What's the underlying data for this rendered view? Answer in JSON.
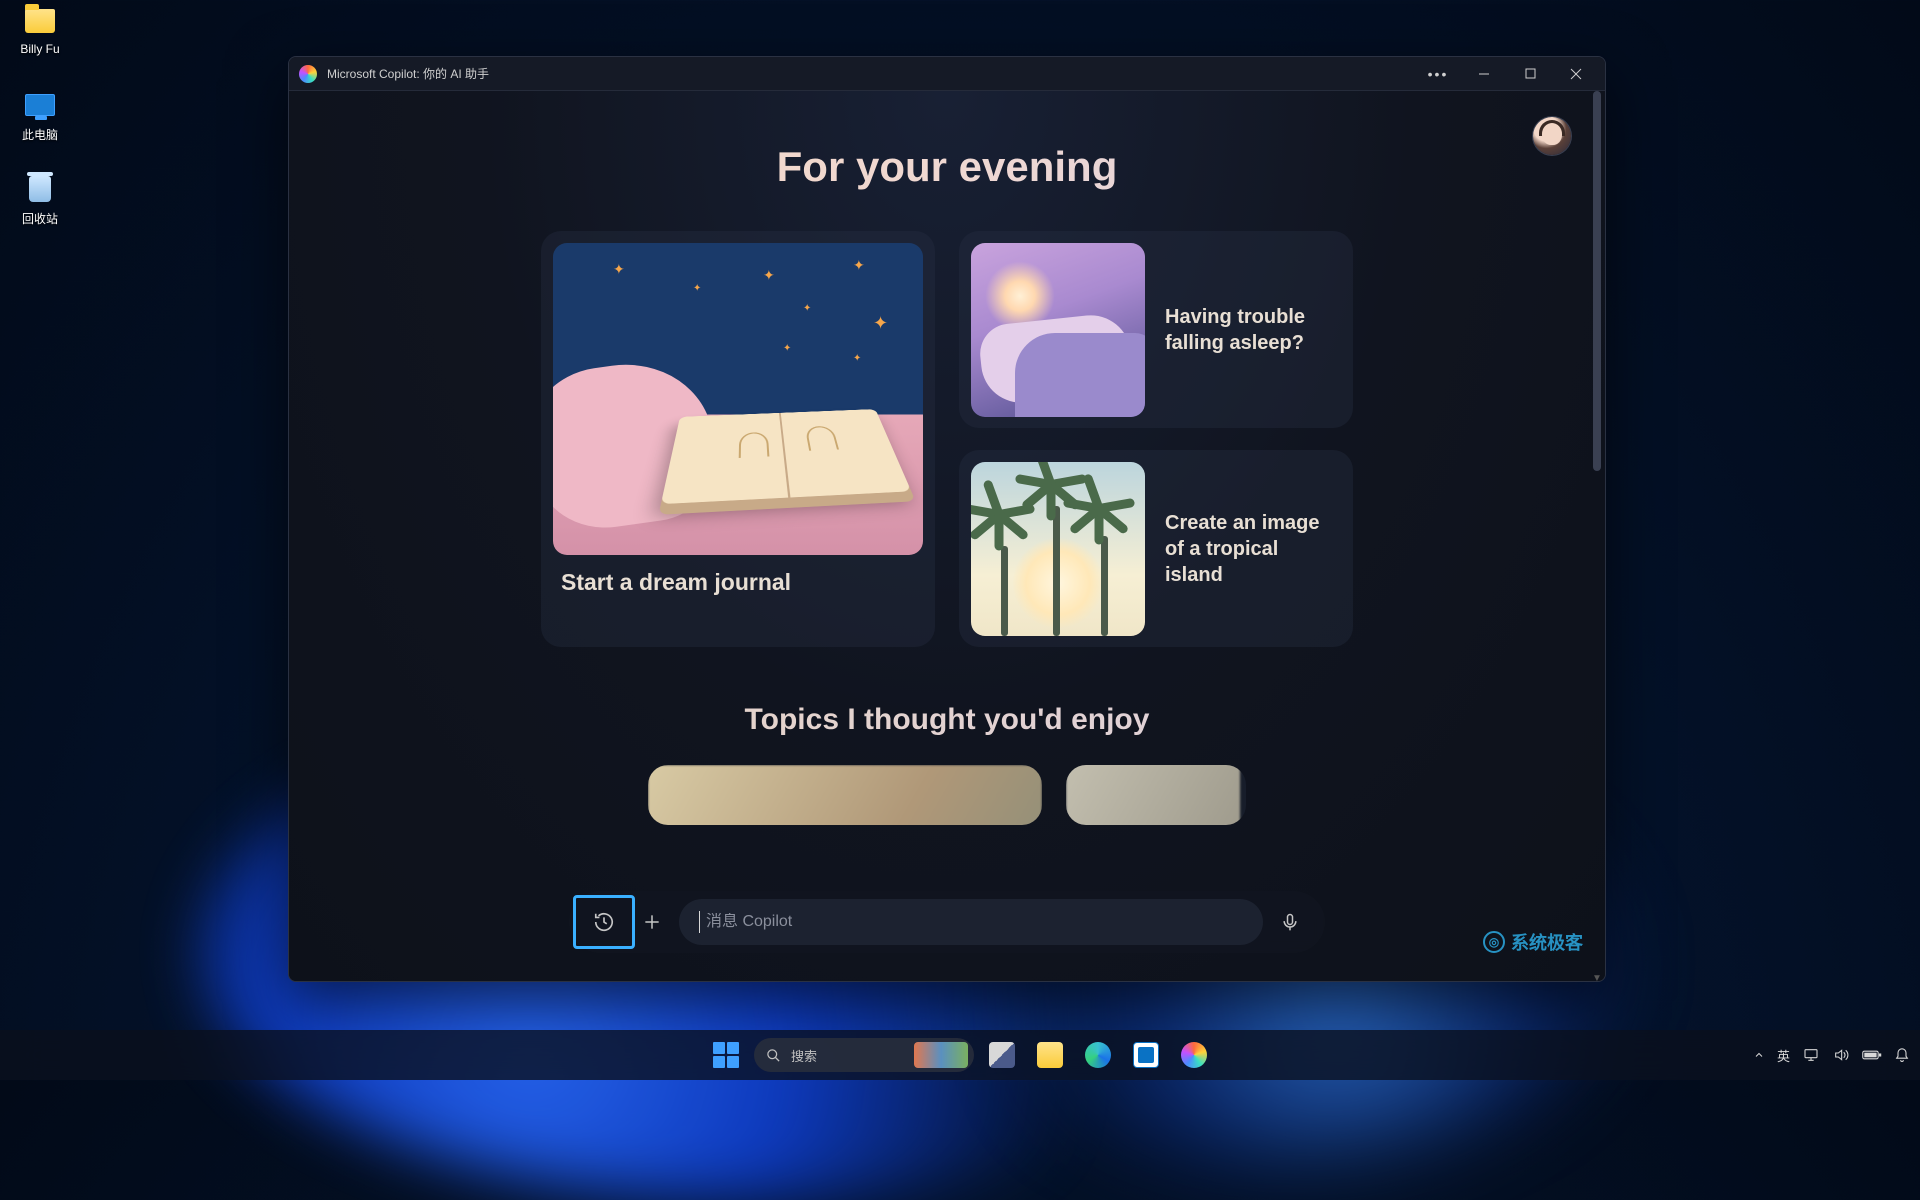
{
  "desktop": {
    "icons": [
      {
        "label": "Billy Fu"
      },
      {
        "label": "此电脑"
      },
      {
        "label": "回收站"
      }
    ]
  },
  "window": {
    "title": "Microsoft Copilot: 你的 AI 助手"
  },
  "headings": {
    "primary": "For your evening",
    "secondary": "Topics I thought you'd enjoy"
  },
  "cards": {
    "large": "Start a dream journal",
    "small1": "Having trouble falling asleep?",
    "small2": "Create an image of a tropical island"
  },
  "input": {
    "placeholder": "消息 Copilot"
  },
  "watermark": {
    "text": "系统极客"
  },
  "taskbar": {
    "search_placeholder": "搜索",
    "ime": "英"
  }
}
